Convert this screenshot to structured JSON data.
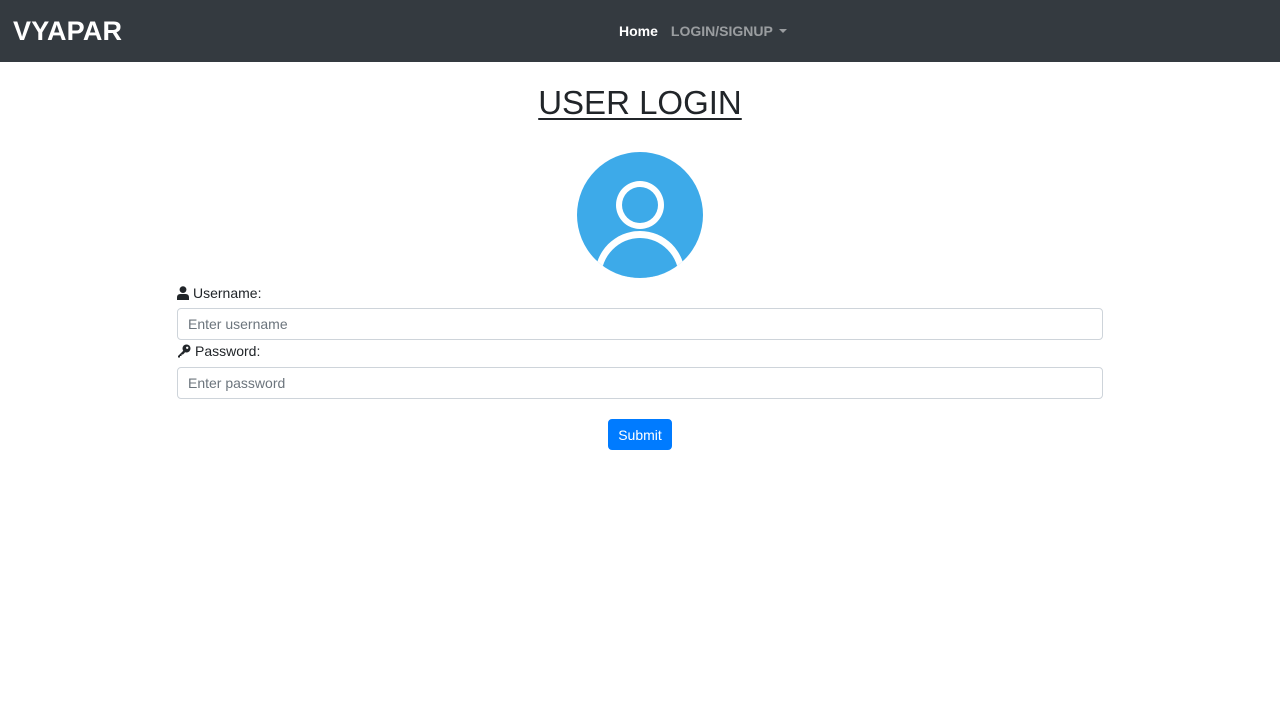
{
  "navbar": {
    "brand": "VYAPAR",
    "home_label": "Home",
    "dropdown_label": "LOGIN/SIGNUP"
  },
  "main": {
    "title": "USER LOGIN",
    "avatar_icon": "user-avatar-icon",
    "username": {
      "label": "Username:",
      "icon": "user-icon",
      "placeholder": "Enter username",
      "value": ""
    },
    "password": {
      "label": "Password:",
      "icon": "key-icon",
      "placeholder": "Enter password",
      "value": ""
    },
    "submit_label": "Submit"
  },
  "colors": {
    "navbar_bg": "#343a40",
    "avatar_blue": "#3daae9",
    "button_primary": "#007bff"
  }
}
